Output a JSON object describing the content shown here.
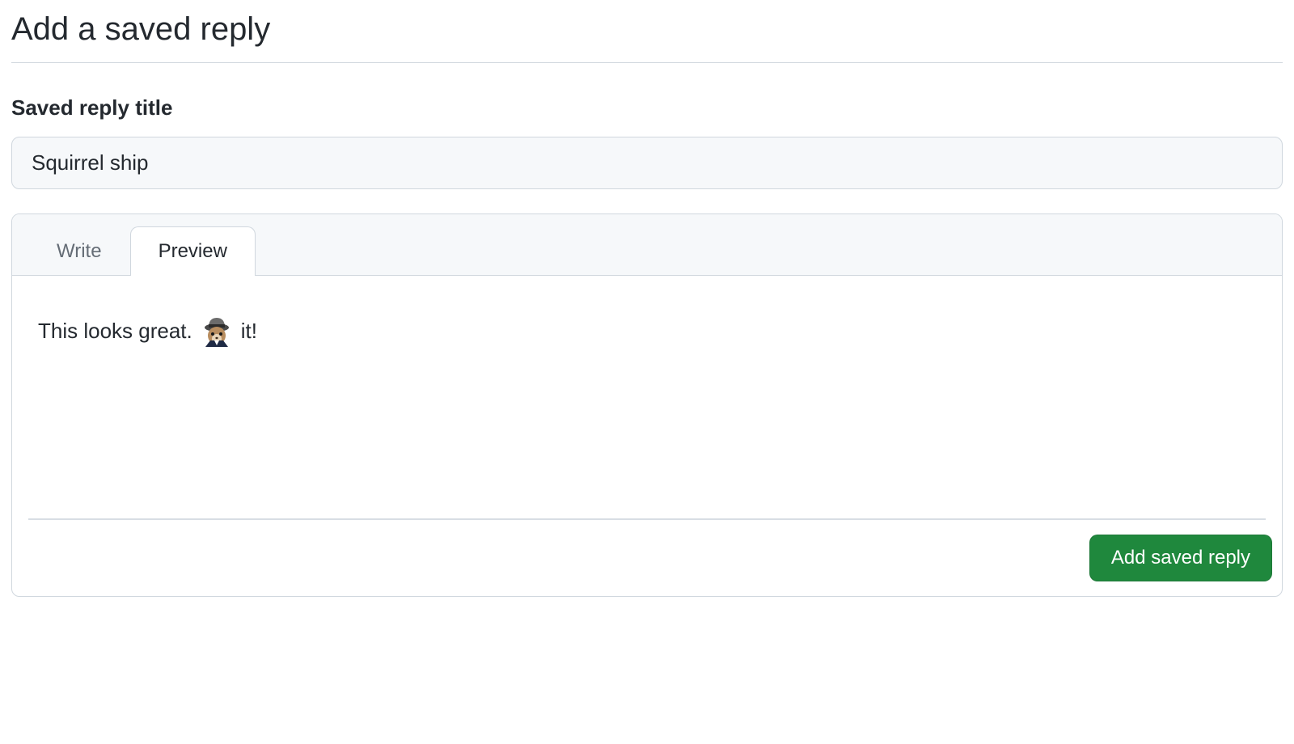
{
  "header": {
    "title": "Add a saved reply"
  },
  "titleField": {
    "label": "Saved reply title",
    "value": "Squirrel ship"
  },
  "editor": {
    "tabs": {
      "write": "Write",
      "preview": "Preview"
    },
    "active_tab": "preview",
    "preview": {
      "text_before": "This looks great.",
      "emoji_name": "shipit-squirrel",
      "text_after": "it!"
    }
  },
  "actions": {
    "submit_label": "Add saved reply"
  }
}
